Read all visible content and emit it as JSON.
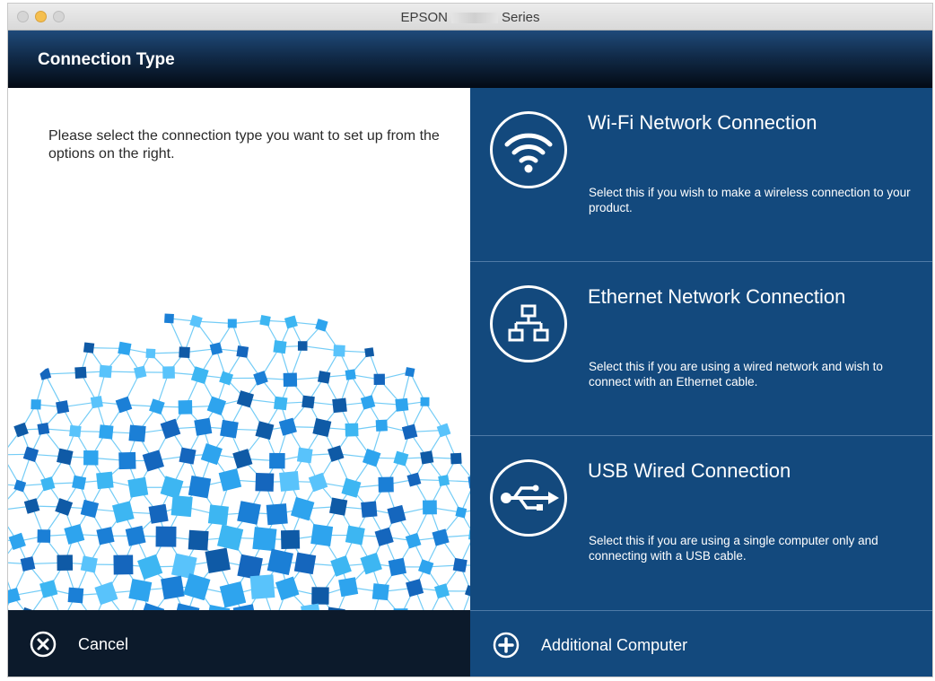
{
  "window": {
    "title_prefix": "EPSON",
    "title_suffix": "Series"
  },
  "header": {
    "title": "Connection Type"
  },
  "instruction": "Please select the connection type you want to set up from the options on the right.",
  "options": [
    {
      "title": "Wi-Fi Network Connection",
      "description": "Select this if you wish to make a wireless connection to your product.",
      "icon": "wifi-icon"
    },
    {
      "title": "Ethernet Network Connection",
      "description": "Select this if you are using a wired network and wish to connect with an Ethernet cable.",
      "icon": "ethernet-icon"
    },
    {
      "title": "USB Wired Connection",
      "description": "Select this if you are using a single computer only and connecting with a USB cable.",
      "icon": "usb-icon"
    }
  ],
  "footer": {
    "cancel_label": "Cancel",
    "cancel_icon": "close-circle-icon",
    "additional_label": "Additional Computer",
    "additional_icon": "plus-circle-icon"
  },
  "colors": {
    "panel_blue": "#13497d",
    "footer_dark": "#0c1a2b",
    "header_dark": "#030a14",
    "globe_blue": "#2e9be6"
  }
}
